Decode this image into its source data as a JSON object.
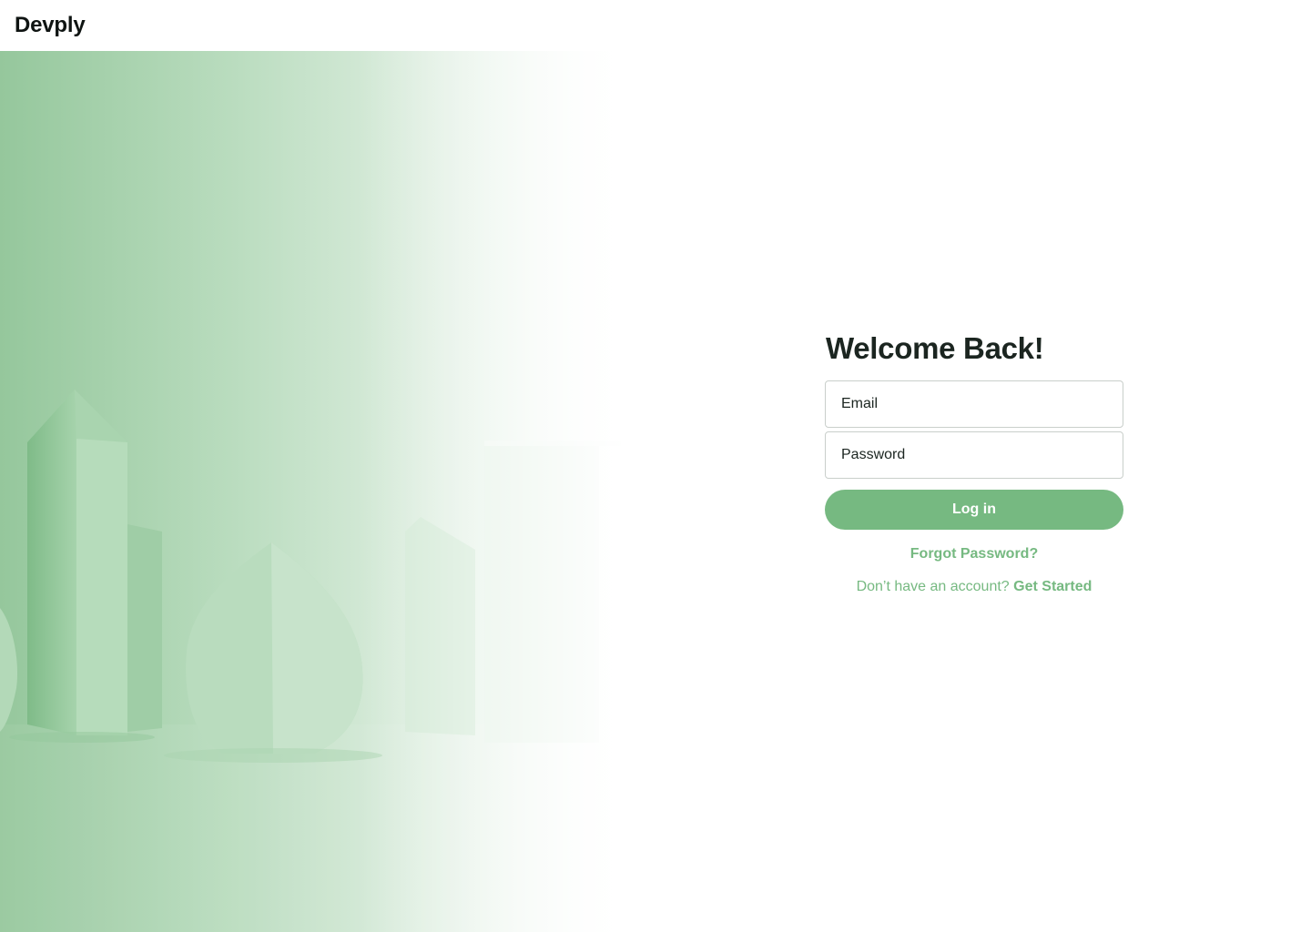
{
  "header": {
    "logo_text": "Devply"
  },
  "hero": {
    "image_icon": "green-geometric-shapes-illustration",
    "accent_color": "#76b981"
  },
  "login": {
    "title": "Welcome Back!",
    "email_placeholder": "Email",
    "password_placeholder": "Password",
    "login_label": "Log in",
    "forgot_label": "Forgot Password?",
    "signup_prompt": "Don’t have an account?",
    "signup_link": "Get Started"
  }
}
